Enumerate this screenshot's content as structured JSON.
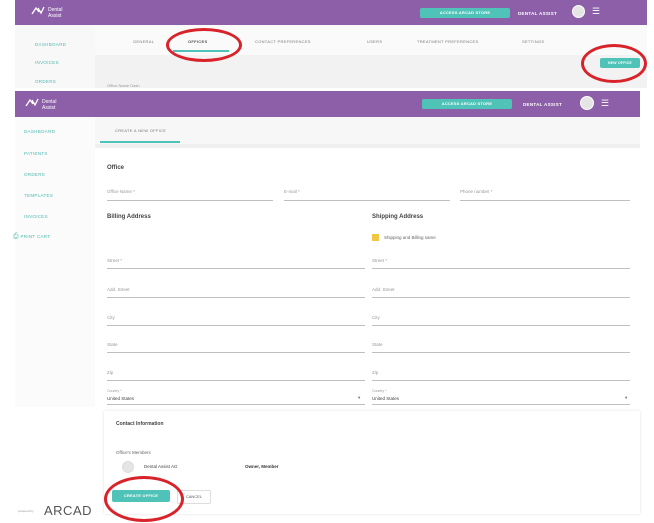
{
  "screen1": {
    "brand": {
      "line1": "Dental",
      "line2": "Assist"
    },
    "header_button": "ACCESS ARCAD STORE",
    "user_name": "DENTAL ASSIST",
    "sidebar": [
      "DASHBOARD",
      "INVOICES",
      "ORDERS"
    ],
    "tabs": [
      "GENERAL",
      "OFFICES",
      "CONTACT PREFERENCES",
      "USERS",
      "TREATMENT PREFERENCES",
      "SETTINGS"
    ],
    "new_office_button": "NEW OFFICE",
    "breadcrumb": "Office Name Dash"
  },
  "screen2": {
    "brand": {
      "line1": "Dental",
      "line2": "Assist"
    },
    "header_button": "ACCESS ARCAD STORE",
    "user_name": "DENTAL ASSIST",
    "sidebar": [
      "DASHBOARD",
      "PATIENTS",
      "ORDERS",
      "TEMPLATES",
      "INVOICES",
      "PRINT CART"
    ],
    "form_tab": "CREATE A NEW OFFICE",
    "office_title": "Office",
    "office_fields": [
      "Office Name *",
      "E-mail *",
      "Phone number *"
    ],
    "billing_title": "Billing Address",
    "shipping_title": "Shipping Address",
    "same_checkbox_label": "Shipping and Billing same",
    "billing_fields": [
      "Street *",
      "Add. Street",
      "City",
      "State",
      "Zip"
    ],
    "shipping_fields": [
      "Street *",
      "Add. Street",
      "City",
      "State",
      "Zip"
    ],
    "country_label": "Country *",
    "country_value": "United States",
    "contact_title": "Contact Information",
    "members_label": "Office's Members",
    "member_name": "Dental Assist AG",
    "member_role": "Owner, Member",
    "create_button": "CREATE OFFICE",
    "cancel_button": "CANCEL",
    "footer_powered": "powered by",
    "footer_brand": "ARCAD"
  },
  "colors": {
    "header": "#8c5fa8",
    "accent": "#4fc3b8",
    "highlight_ring": "#d8232a"
  }
}
